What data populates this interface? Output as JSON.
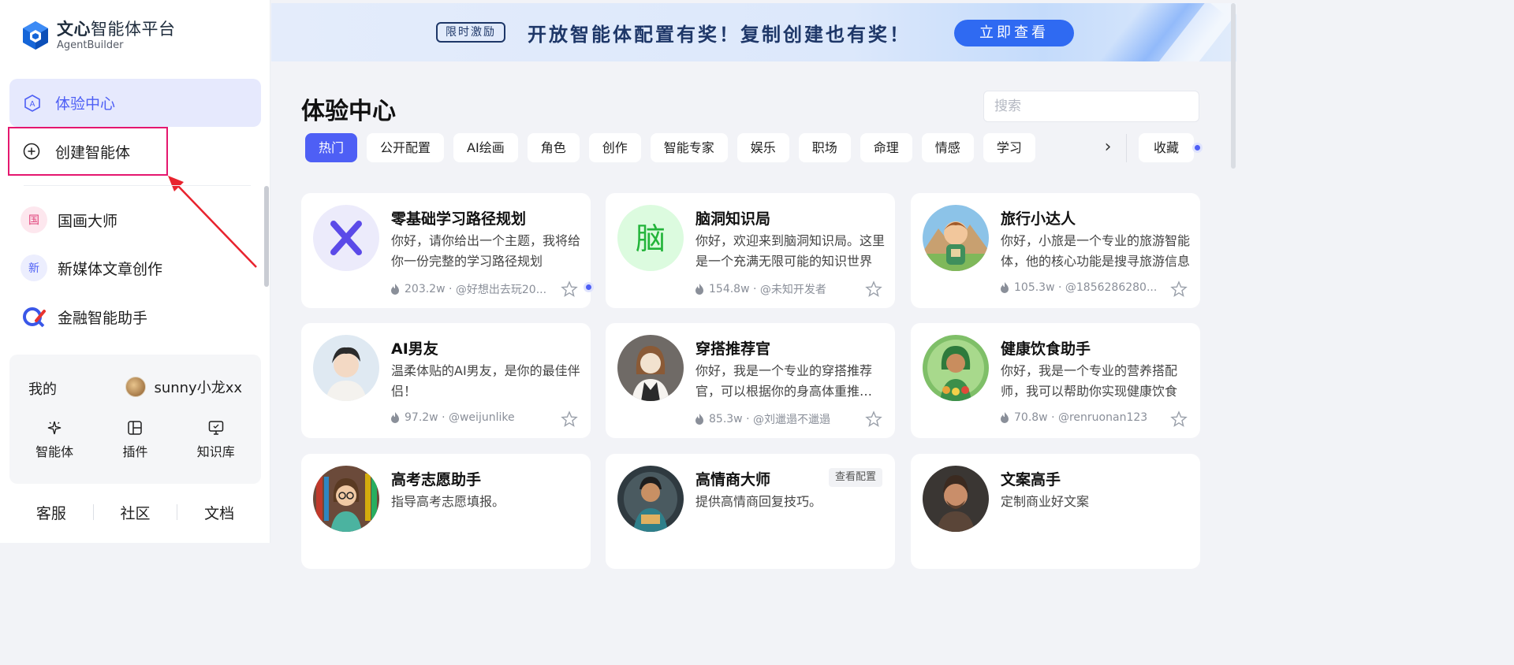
{
  "brand": {
    "name_bold": "文心",
    "name_rest": "智能体平台",
    "sub": "AgentBuilder"
  },
  "sidebar": {
    "active_item": "体验中心",
    "create_item": "创建智能体",
    "recent": [
      {
        "label": "国画大师",
        "badge": "国"
      },
      {
        "label": "新媒体文章创作",
        "badge": "新"
      },
      {
        "label": "金融智能助手",
        "badge": ""
      }
    ],
    "my": {
      "title": "我的",
      "username": "sunny小龙xx",
      "tools": [
        {
          "label": "智能体",
          "icon": "sparkle-icon"
        },
        {
          "label": "插件",
          "icon": "plugin-icon"
        },
        {
          "label": "知识库",
          "icon": "monitor-icon"
        }
      ]
    },
    "footer": [
      "客服",
      "社区",
      "文档"
    ]
  },
  "banner": {
    "tag": "限时激励",
    "text": "开放智能体配置有奖！复制创建也有奖！",
    "button": "立即查看"
  },
  "main": {
    "title": "体验中心",
    "search_placeholder": "搜索",
    "tabs": [
      "热门",
      "公开配置",
      "AI绘画",
      "角色",
      "创作",
      "智能专家",
      "娱乐",
      "职场",
      "命理",
      "情感",
      "学习"
    ],
    "active_tab": "热门",
    "next_label": "›",
    "favorites": "收藏"
  },
  "cards": [
    {
      "name": "零基础学习路径规划",
      "desc": "你好，请你给出一个主题，我将给你一份完整的学习路径规划",
      "heat": "203.2w",
      "author": "@好想出去玩20...",
      "avatar_text": "X",
      "avatar_bg": "#ecebfb",
      "avatar_fg": "#5b4ae8"
    },
    {
      "name": "脑洞知识局",
      "desc": "你好，欢迎来到脑洞知识局。这里是一个充满无限可能的知识世界",
      "heat": "154.8w",
      "author": "@未知开发者",
      "avatar_text": "脑",
      "avatar_bg": "#dcfbdf",
      "avatar_fg": "#23b43a"
    },
    {
      "name": "旅行小达人",
      "desc": "你好，小旅是一个专业的旅游智能体，他的核心功能是搜寻旅游信息",
      "heat": "105.3w",
      "author": "@1856286280...",
      "avatar_text": "",
      "avatar_bg": "#8cc3e8",
      "avatar_fg": "#c8743a"
    },
    {
      "name": "AI男友",
      "desc": "温柔体贴的AI男友，是你的最佳伴侣！",
      "heat": "97.2w",
      "author": "@weijunlike",
      "avatar_text": "",
      "avatar_bg": "#dfe9f2",
      "avatar_fg": "#2b2b2b"
    },
    {
      "name": "穿搭推荐官",
      "desc": "你好，我是一个专业的穿搭推荐官，可以根据你的身高体重推荐穿搭",
      "heat": "85.3w",
      "author": "@刘邋遢不邋遢",
      "avatar_text": "",
      "avatar_bg": "#6f6a66",
      "avatar_fg": "#f2e2cf"
    },
    {
      "name": "健康饮食助手",
      "desc": "你好，我是一个专业的营养搭配师，我可以帮助你实现健康饮食",
      "heat": "70.8w",
      "author": "@renruonan123",
      "avatar_text": "",
      "avatar_bg": "#7fbf68",
      "avatar_fg": "#2e7a3c"
    },
    {
      "name": "高考志愿助手",
      "desc": "指导高考志愿填报。",
      "heat": "",
      "author": "",
      "avatar_text": "",
      "avatar_bg": "#6b4a3a",
      "avatar_fg": "#4bb3a0"
    },
    {
      "name": "高情商大师",
      "desc": "提供高情商回复技巧。",
      "heat": "",
      "author": "",
      "config": "查看配置",
      "avatar_text": "",
      "avatar_bg": "#2f3a40",
      "avatar_fg": "#e0b060"
    },
    {
      "name": "文案高手",
      "desc": "定制商业好文案",
      "heat": "",
      "author": "",
      "avatar_text": "",
      "avatar_bg": "#3a3633",
      "avatar_fg": "#c98e6a"
    }
  ]
}
